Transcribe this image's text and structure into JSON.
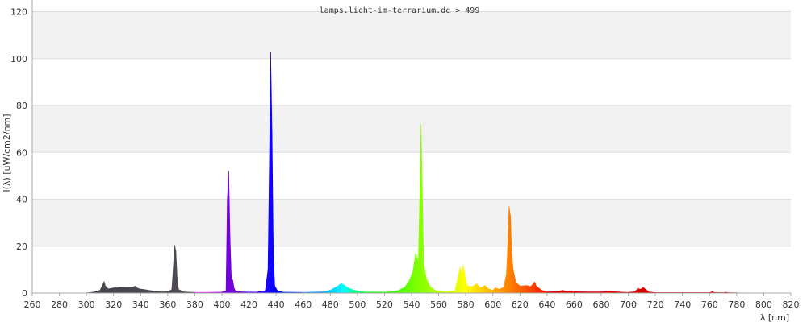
{
  "chart_data": {
    "type": "area",
    "title": "lamps.licht-im-terrarium.de > 499",
    "xlabel": "λ [nm]",
    "ylabel": "I(λ)  [uW/cm2/nm]",
    "xlim": [
      260,
      820
    ],
    "ylim": [
      0,
      125
    ],
    "x_ticks": [
      260,
      280,
      300,
      320,
      340,
      360,
      380,
      400,
      420,
      440,
      460,
      480,
      500,
      520,
      540,
      560,
      580,
      600,
      620,
      640,
      660,
      680,
      700,
      720,
      740,
      760,
      780,
      800,
      820
    ],
    "y_ticks": [
      0,
      20,
      40,
      60,
      80,
      100,
      120
    ],
    "grid": "horizontal alternating bands",
    "background_bands": [
      "#ffffff",
      "#f2f2f2"
    ],
    "spectrum": [
      [
        298,
        0.0
      ],
      [
        305,
        0.4
      ],
      [
        310,
        1.2
      ],
      [
        312,
        3.5
      ],
      [
        313,
        5.0
      ],
      [
        314,
        3.0
      ],
      [
        316,
        1.8
      ],
      [
        320,
        2.2
      ],
      [
        325,
        2.5
      ],
      [
        330,
        2.4
      ],
      [
        334,
        2.5
      ],
      [
        336,
        2.9
      ],
      [
        338,
        2.0
      ],
      [
        340,
        1.7
      ],
      [
        344,
        1.4
      ],
      [
        348,
        1.0
      ],
      [
        352,
        0.7
      ],
      [
        356,
        0.5
      ],
      [
        360,
        0.6
      ],
      [
        363,
        1.5
      ],
      [
        364,
        10.0
      ],
      [
        365,
        20.5
      ],
      [
        366,
        18.0
      ],
      [
        367,
        6.0
      ],
      [
        368,
        1.5
      ],
      [
        372,
        0.5
      ],
      [
        380,
        0.3
      ],
      [
        390,
        0.3
      ],
      [
        400,
        0.4
      ],
      [
        403,
        1.0
      ],
      [
        404,
        40.0
      ],
      [
        405,
        52.0
      ],
      [
        406,
        24.0
      ],
      [
        407,
        6.0
      ],
      [
        408,
        5.5
      ],
      [
        409,
        2.0
      ],
      [
        410,
        1.0
      ],
      [
        415,
        0.5
      ],
      [
        425,
        0.4
      ],
      [
        432,
        1.0
      ],
      [
        434,
        10.0
      ],
      [
        435,
        53.0
      ],
      [
        436,
        103.0
      ],
      [
        437,
        68.0
      ],
      [
        438,
        16.0
      ],
      [
        439,
        3.0
      ],
      [
        441,
        1.0
      ],
      [
        445,
        0.4
      ],
      [
        460,
        0.3
      ],
      [
        475,
        0.5
      ],
      [
        480,
        1.2
      ],
      [
        485,
        2.8
      ],
      [
        488,
        4.0
      ],
      [
        490,
        3.5
      ],
      [
        493,
        2.2
      ],
      [
        497,
        1.3
      ],
      [
        502,
        0.7
      ],
      [
        507,
        0.4
      ],
      [
        520,
        0.4
      ],
      [
        530,
        1.0
      ],
      [
        535,
        2.5
      ],
      [
        538,
        5.0
      ],
      [
        541,
        9.0
      ],
      [
        543,
        17.0
      ],
      [
        545,
        13.0
      ],
      [
        546,
        40.0
      ],
      [
        547,
        72.0
      ],
      [
        548,
        40.0
      ],
      [
        549,
        12.0
      ],
      [
        551,
        6.0
      ],
      [
        554,
        2.5
      ],
      [
        558,
        1.0
      ],
      [
        565,
        0.6
      ],
      [
        572,
        1.0
      ],
      [
        576,
        11.0
      ],
      [
        577,
        8.0
      ],
      [
        578,
        12.0
      ],
      [
        579,
        9.0
      ],
      [
        581,
        3.0
      ],
      [
        585,
        2.8
      ],
      [
        588,
        4.0
      ],
      [
        591,
        2.2
      ],
      [
        594,
        3.2
      ],
      [
        597,
        1.7
      ],
      [
        600,
        1.2
      ],
      [
        602,
        2.2
      ],
      [
        605,
        1.6
      ],
      [
        608,
        2.5
      ],
      [
        610,
        8.0
      ],
      [
        611,
        20.0
      ],
      [
        612,
        37.0
      ],
      [
        613,
        33.0
      ],
      [
        614,
        16.0
      ],
      [
        615,
        10.0
      ],
      [
        617,
        4.5
      ],
      [
        620,
        3.0
      ],
      [
        625,
        3.2
      ],
      [
        628,
        2.8
      ],
      [
        631,
        4.7
      ],
      [
        632,
        3.0
      ],
      [
        636,
        1.2
      ],
      [
        640,
        0.5
      ],
      [
        645,
        0.6
      ],
      [
        650,
        0.9
      ],
      [
        651,
        1.2
      ],
      [
        654,
        0.8
      ],
      [
        658,
        0.8
      ],
      [
        662,
        0.6
      ],
      [
        670,
        0.5
      ],
      [
        680,
        0.5
      ],
      [
        686,
        0.8
      ],
      [
        690,
        0.6
      ],
      [
        695,
        0.4
      ],
      [
        700,
        0.3
      ],
      [
        705,
        0.6
      ],
      [
        707,
        2.0
      ],
      [
        709,
        1.6
      ],
      [
        711,
        2.4
      ],
      [
        713,
        1.5
      ],
      [
        715,
        0.5
      ],
      [
        720,
        0.2
      ],
      [
        740,
        0.2
      ],
      [
        760,
        0.2
      ],
      [
        762,
        0.6
      ],
      [
        764,
        0.2
      ],
      [
        771,
        0.2
      ],
      [
        772,
        0.4
      ],
      [
        773,
        0.2
      ],
      [
        780,
        0.1
      ],
      [
        800,
        0.0
      ]
    ]
  }
}
